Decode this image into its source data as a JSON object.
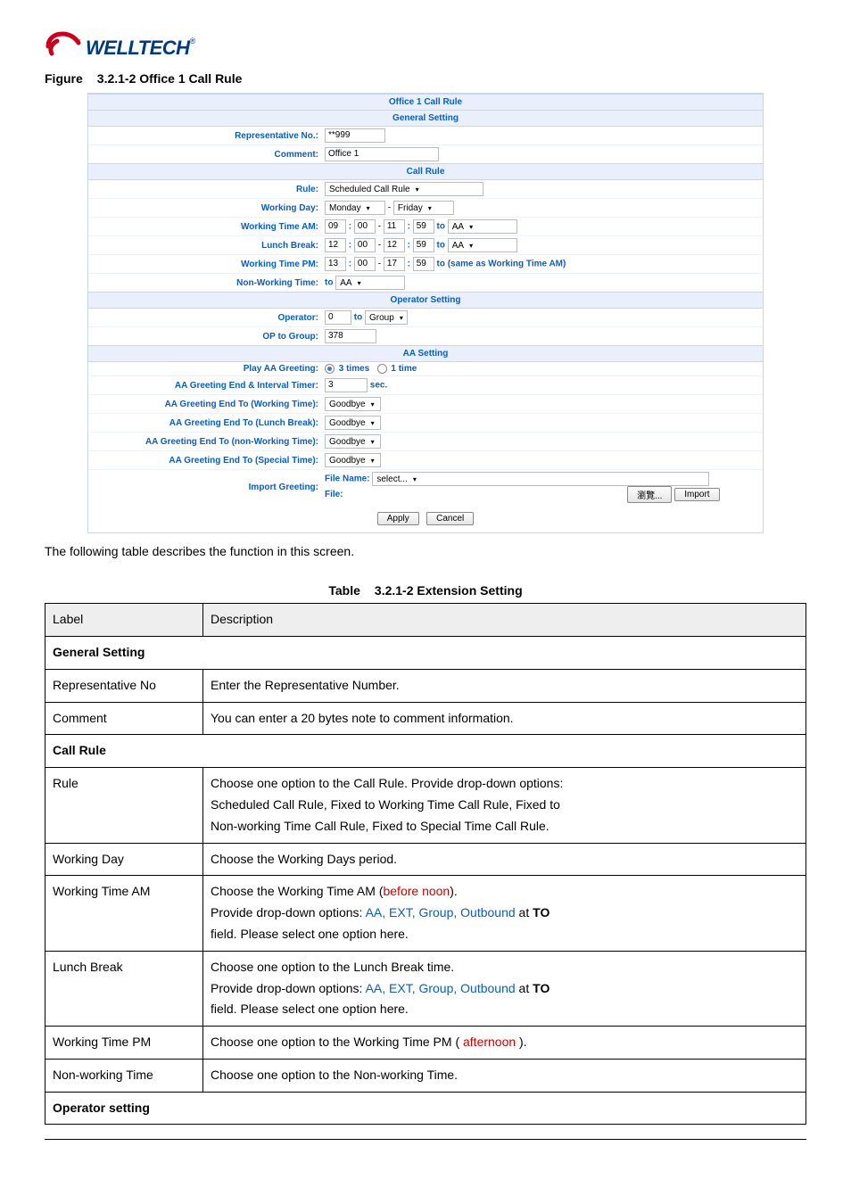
{
  "logo": {
    "text": "WELLTECH",
    "reg": "®"
  },
  "figure_caption": {
    "prefix": "Figure",
    "number": "3.2.1-2 Office 1 Call Rule"
  },
  "panel": {
    "title": "Office 1 Call Rule",
    "sections": {
      "general": "General Setting",
      "callrule": "Call Rule",
      "operator": "Operator Setting",
      "aa": "AA Setting"
    },
    "rows": {
      "rep_no": {
        "label": "Representative No.:",
        "value": "**999"
      },
      "comment": {
        "label": "Comment:",
        "value": "Office 1"
      },
      "rule": {
        "label": "Rule:",
        "value": "Scheduled Call Rule"
      },
      "working_day": {
        "label": "Working Day:",
        "from": "Monday",
        "sep": "-",
        "to": "Friday"
      },
      "working_am": {
        "label": "Working Time AM:",
        "h1": "09",
        "m1": "00",
        "sep": "-",
        "h2": "11",
        "m2": "59",
        "to_label": "to",
        "dest": "AA"
      },
      "lunch": {
        "label": "Lunch Break:",
        "h1": "12",
        "m1": "00",
        "sep": "-",
        "h2": "12",
        "m2": "59",
        "to_label": "to",
        "dest": "AA"
      },
      "working_pm": {
        "label": "Working Time PM:",
        "h1": "13",
        "m1": "00",
        "sep": "-",
        "h2": "17",
        "m2": "59",
        "to_label": "to (same as Working Time AM)"
      },
      "nonworking": {
        "label": "Non-Working Time:",
        "to_label": "to",
        "dest": "AA"
      },
      "operator": {
        "label": "Operator:",
        "value": "0",
        "to_label": "to",
        "dest": "Group"
      },
      "op_group": {
        "label": "OP to Group:",
        "value": "378"
      },
      "play_aa": {
        "label": "Play AA Greeting:",
        "opt1": "3 times",
        "opt2": "1 time"
      },
      "interval": {
        "label": "AA Greeting End & Interval Timer:",
        "value": "3",
        "unit": "sec."
      },
      "end_working": {
        "label": "AA Greeting End To (Working Time):",
        "value": "Goodbye"
      },
      "end_lunch": {
        "label": "AA Greeting End To (Lunch Break):",
        "value": "Goodbye"
      },
      "end_nonworking": {
        "label": "AA Greeting End To (non-Working Time):",
        "value": "Goodbye"
      },
      "end_special": {
        "label": "AA Greeting End To (Special Time):",
        "value": "Goodbye"
      },
      "import": {
        "label": "Import Greeting:",
        "filename_label": "File Name:",
        "filename_value": "select...",
        "file_label": "File:",
        "browse": "瀏覽...",
        "import_btn": "Import"
      }
    },
    "buttons": {
      "apply": "Apply",
      "cancel": "Cancel"
    }
  },
  "body_text": "The following table describes the function in this screen.",
  "table_caption": {
    "prefix": "Table",
    "number": "3.2.1-2 Extension Setting"
  },
  "desc": {
    "header": {
      "label": "Label",
      "desc": "Description"
    },
    "sections": {
      "general": "General Setting",
      "callrule": "Call Rule",
      "operator": "Operator setting"
    },
    "rows": {
      "rep": {
        "label": "Representative No",
        "desc": "Enter the Representative Number."
      },
      "comment": {
        "label": "Comment",
        "desc": "You can enter a 20 bytes note to comment information."
      },
      "rule": {
        "label": "Rule",
        "l1": "Choose one option to the Call Rule. Provide drop-down options:",
        "l2": "Scheduled Call Rule, Fixed to Working Time Call Rule, Fixed to",
        "l3": "Non-working Time Call Rule, Fixed to Special Time Call Rule."
      },
      "wday": {
        "label": "Working Day",
        "desc": "Choose the Working Days period."
      },
      "wam": {
        "label": "Working Time AM",
        "l1a": "Choose the Working Time AM (",
        "l1b": "before noon",
        "l1c": ").",
        "l2a": "Provide drop-down options: ",
        "l2b": "AA, EXT, Group, Outbound",
        "l2c": " at ",
        "l2d": "TO",
        "l3": "field. Please select one option here."
      },
      "lunch": {
        "label": "Lunch Break",
        "l1": "Choose one option to the Lunch Break time.",
        "l2a": "Provide drop-down options: ",
        "l2b": "AA, EXT, Group, Outbound",
        "l2c": " at ",
        "l2d": "TO",
        "l3": "field. Please select one option here."
      },
      "wpm": {
        "label": "Working Time PM",
        "l1a": "Choose one option to the Working Time PM ( ",
        "l1b": "afternoon",
        "l1c": " )."
      },
      "nw": {
        "label": "Non-working Time",
        "desc": "Choose one option to the Non-working Time."
      }
    }
  }
}
